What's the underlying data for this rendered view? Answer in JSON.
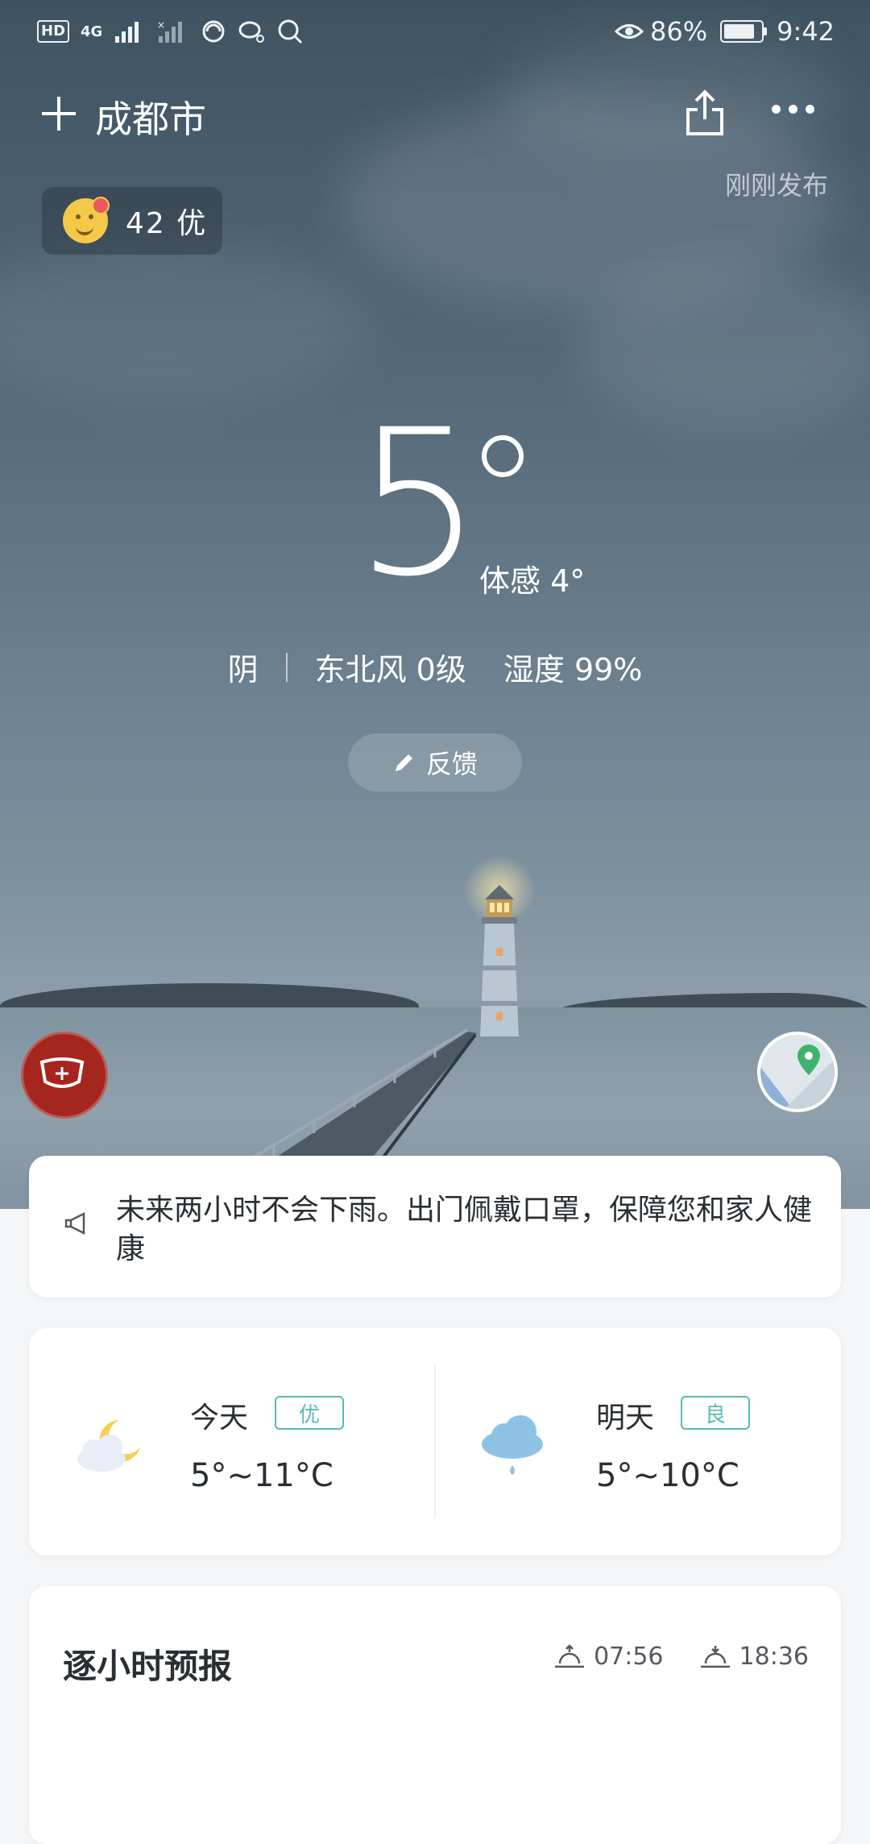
{
  "status_bar": {
    "network_label": "HD",
    "network_type": "4G",
    "battery_percent": "86%",
    "battery_level": 0.86,
    "time": "9:42"
  },
  "header": {
    "city": "成都市",
    "publish_status": "刚刚发布"
  },
  "air_quality": {
    "text": "42 优",
    "face_color": "#f3c948"
  },
  "current": {
    "temperature": "5",
    "feels_like": "体感 4°",
    "weather": "阴",
    "wind": "东北风 0级",
    "humidity": "湿度 99%"
  },
  "feedback": {
    "label": "反馈"
  },
  "notice": {
    "text": "未来两小时不会下雨。出门佩戴口罩，保障您和家人健康"
  },
  "forecast": [
    {
      "day": "今天",
      "aqi_label": "优",
      "range": "5°~11°C",
      "icon": "moon-cloud-icon"
    },
    {
      "day": "明天",
      "aqi_label": "良",
      "range": "5°~10°C",
      "icon": "rain-cloud-icon"
    }
  ],
  "hourly": {
    "title": "逐小时预报",
    "sunrise": "07:56",
    "sunset": "18:36"
  },
  "colors": {
    "badge_accent": "#5cb9b2",
    "mask_button": "#a5261f",
    "map_pin": "#3fb36d"
  }
}
